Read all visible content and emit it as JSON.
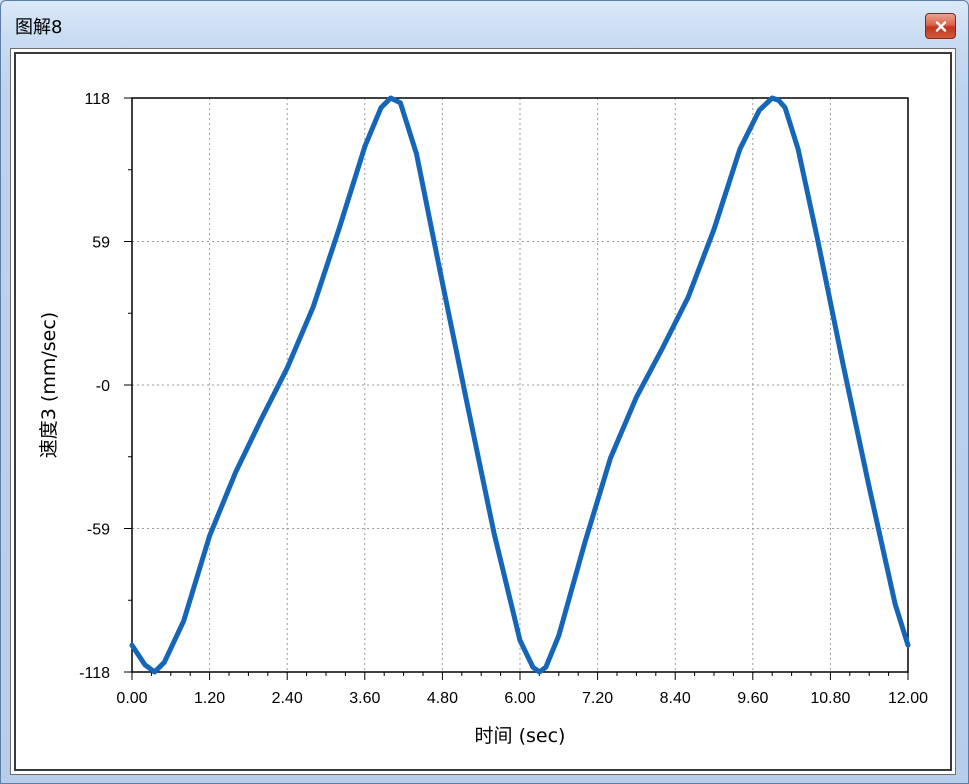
{
  "window": {
    "title": "图解8"
  },
  "chart_data": {
    "type": "line",
    "xlabel": "时间 (sec)",
    "ylabel": "速度3 (mm/sec)",
    "xlim": [
      0,
      12
    ],
    "ylim": [
      -118,
      118
    ],
    "x_ticks": [
      "0.00",
      "1.20",
      "2.40",
      "3.60",
      "4.80",
      "6.00",
      "7.20",
      "8.40",
      "9.60",
      "10.80",
      "12.00"
    ],
    "y_ticks": [
      "118",
      "59",
      "-0",
      "-59",
      "-118"
    ],
    "y_tick_values": [
      118,
      59,
      0,
      -59,
      -118
    ],
    "grid": true,
    "series": [
      {
        "color": "#1565b8",
        "x": [
          0.0,
          0.2,
          0.35,
          0.5,
          0.8,
          1.2,
          1.6,
          2.0,
          2.4,
          2.8,
          3.2,
          3.6,
          3.85,
          4.0,
          4.15,
          4.4,
          4.8,
          5.2,
          5.6,
          6.0,
          6.2,
          6.3,
          6.4,
          6.6,
          7.0,
          7.4,
          7.8,
          8.2,
          8.6,
          9.0,
          9.4,
          9.7,
          9.9,
          10.0,
          10.1,
          10.3,
          10.6,
          11.0,
          11.4,
          11.8,
          12.0
        ],
        "y": [
          -107,
          -115,
          -118,
          -114,
          -97,
          -62,
          -36,
          -14,
          7,
          32,
          64,
          98,
          114,
          118,
          116,
          95,
          42,
          -10,
          -61,
          -105,
          -116,
          -118,
          -116,
          -103,
          -65,
          -30,
          -5,
          15,
          36,
          64,
          97,
          113,
          118,
          117,
          114,
          97,
          60,
          8,
          -42,
          -90,
          -107
        ]
      }
    ]
  }
}
